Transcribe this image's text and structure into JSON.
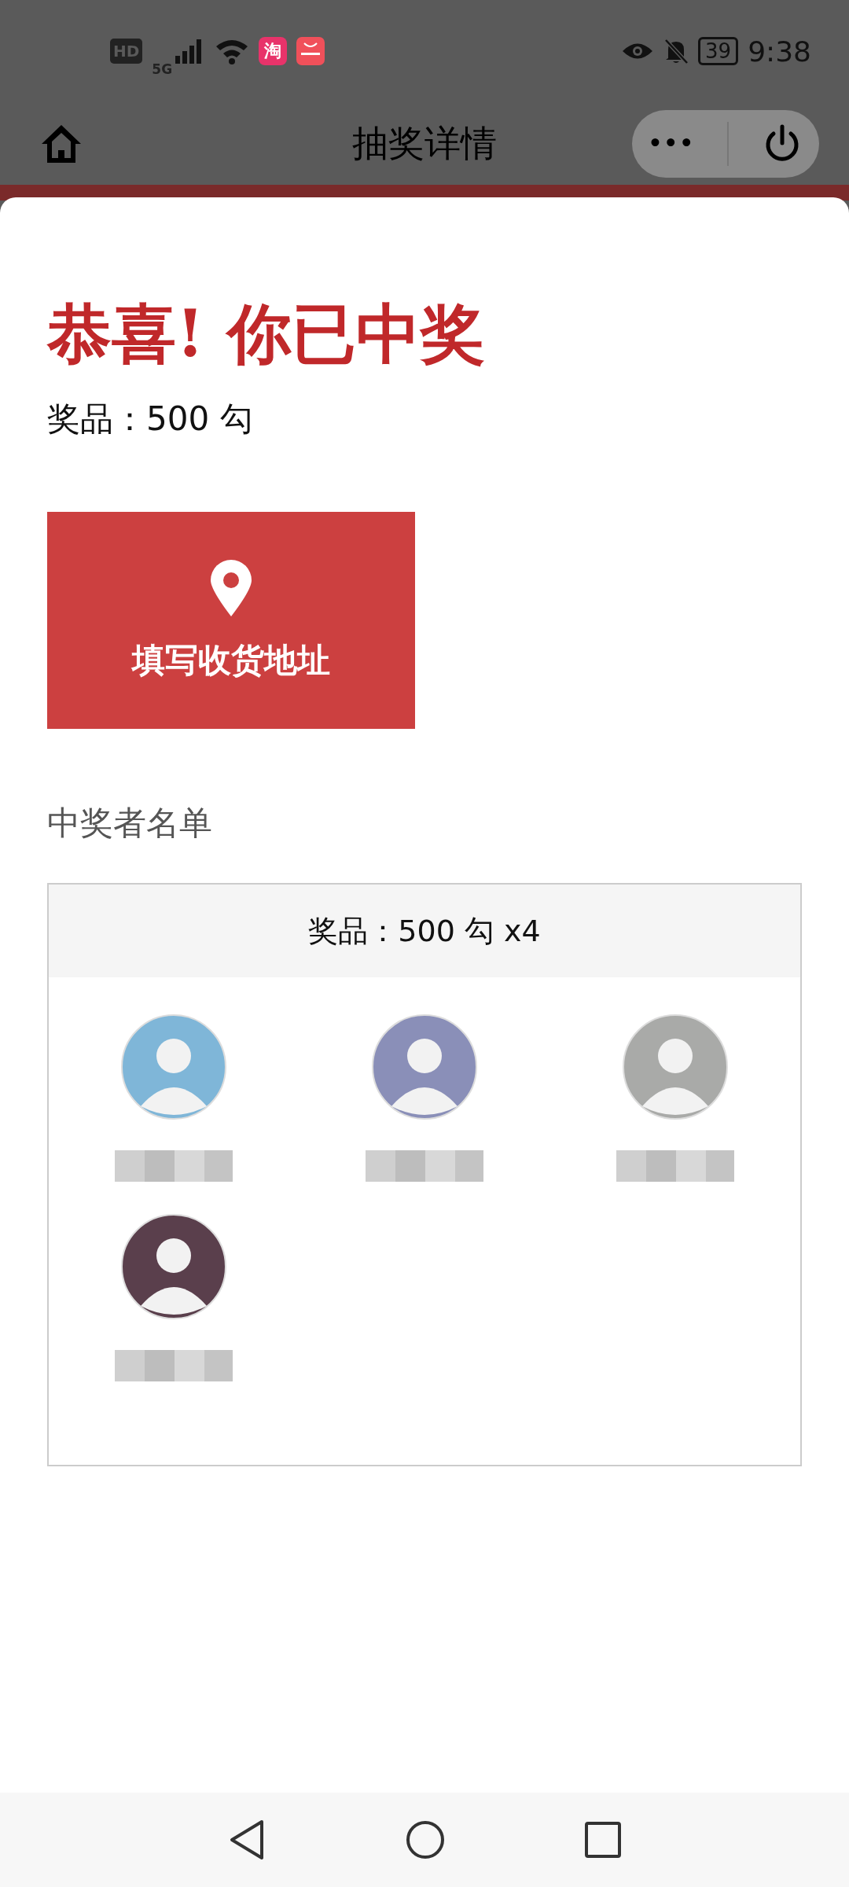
{
  "status_bar": {
    "hd": "HD",
    "network": "5G",
    "app_glyph": "淘",
    "battery": "39",
    "time": "9:38"
  },
  "nav": {
    "title": "抽奖详情",
    "more": "•••"
  },
  "result": {
    "headline": "恭喜! 你已中奖",
    "prize": "奖品：500 勾"
  },
  "address_button": {
    "label": "填写收货地址"
  },
  "winners": {
    "heading": "中奖者名单",
    "prize_line": "奖品：500 勾 x4",
    "people": [
      {
        "kind": "avatar",
        "color": "#7fb6d8"
      },
      {
        "kind": "avatar",
        "color": "#8a8fb8"
      },
      {
        "kind": "avatar",
        "color": "#a9aaa8"
      },
      {
        "kind": "avatar",
        "color": "#5a3f4c"
      }
    ]
  }
}
